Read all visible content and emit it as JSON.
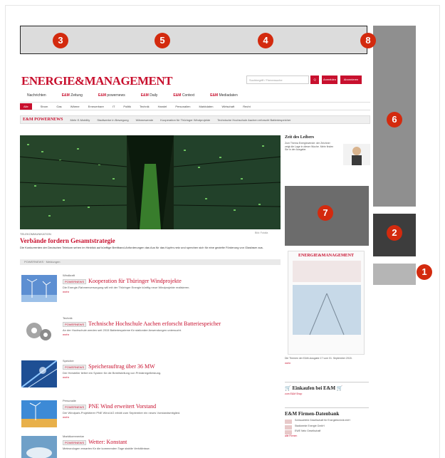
{
  "ad_slots": [
    {
      "number": "1",
      "color": "#b5b5b5"
    },
    {
      "number": "2",
      "color": "#3d3d3d"
    },
    {
      "number": "3",
      "color": "#dcdcdc"
    },
    {
      "number": "4",
      "color": "#dcdcdc"
    },
    {
      "number": "5",
      "color": "#dcdcdc"
    },
    {
      "number": "6",
      "color": "#8f8f8f"
    },
    {
      "number": "7",
      "color": "#6c6c6c"
    },
    {
      "number": "8",
      "color": "#dcdcdc"
    }
  ],
  "site": {
    "logo": "ENERGIE&MANAGEMENT",
    "search_placeholder": "Suchbegriff / Firmensuche",
    "search_button": "Q",
    "login_button": "Anmelden",
    "abo_button": "Abonnieren",
    "brand_color": "#c8102e",
    "nav_primary": [
      {
        "prefix": "",
        "label": "Nachrichten"
      },
      {
        "prefix": "E&M",
        "label": "Zeitung"
      },
      {
        "prefix": "E&M",
        "label": "powernews"
      },
      {
        "prefix": "E&M",
        "label": "Daily"
      },
      {
        "prefix": "E&M",
        "label": "Context"
      },
      {
        "prefix": "E&M",
        "label": "Mediadaten"
      }
    ],
    "nav_secondary": [
      "Alle",
      "Strom",
      "Gas",
      "Wärme",
      "Erneuerbare",
      "IT",
      "Politik",
      "Technik",
      "Handel",
      "Personalien",
      "Marktdaten",
      "Wirtschaft",
      "Recht"
    ],
    "ticker_brand": "E&M POWERNEWS",
    "ticker_items": [
      "Mehr E-Mobility",
      "Stadtwerke in Bewegung",
      "Wärmewende",
      "Kooperation für Thüringer Windprojekte",
      "Technische Hochschule Aachen erforscht Batteriespeicher"
    ],
    "hero": {
      "kicker": "Telekommunikation",
      "headline": "Verbände fordern Gesamtstrategie",
      "teaser": "Die Konkurrenten der Deutschen Telekom sehen im Hinblick auf künftige Breitband-Anforderungen das Aus für das Kupfer-netz und sprechen sich für eine gezielte Förderung von Glasfaser aus.",
      "more": "mehr",
      "credit": "Bild: Fotolia"
    },
    "section_bar": "POWERNEWS · Meldungen",
    "articles": [
      {
        "kicker": "Windkraft",
        "tag": "POWERNEWS",
        "title": "Kooperation für Thüringer Windprojekte",
        "teaser": "Die Energie-Rahmenversorgung will mit der Thüringer Energie künftig neue Windprojekte realisieren.",
        "more": "mehr"
      },
      {
        "kicker": "Technik",
        "tag": "POWERNEWS",
        "title": "Technische Hochschule Aachen erforscht Batteriespeicher",
        "teaser": "An der Hochschule werden seit 2015 Batteriesysteme für stationäre Anwendungen untersucht.",
        "more": "mehr"
      },
      {
        "kicker": "Speicher",
        "tag": "POWERNEWS",
        "title": "Speicherauftrag über 36 MW",
        "teaser": "Der Hersteller liefert ein System für die Bereitstellung von Primärregelleistung.",
        "more": "mehr"
      },
      {
        "kicker": "Personalie",
        "tag": "POWERNEWS",
        "title": "PNE Wind erweitert Vorstand",
        "teaser": "Der Windpark-Projektierer PNE Wind AG erhält zum September ein neues Vorstandsmitglied.",
        "more": "mehr"
      },
      {
        "kicker": "Marktkommentar",
        "tag": "POWERNEWS",
        "title": "Wetter: Konstant",
        "teaser": "Meteorologen erwarten für die kommenden Tage stabile Verhältnisse.",
        "more": "mehr"
      }
    ],
    "sidebar": {
      "cartoon_title": "Zeit des Leibers",
      "cartoon_text": "Zum Thema Energiewende: der Zeichner zeigt die Lage in dieser Woche. Mehr finden Sie in der Ausgabe.",
      "mag_logo": "ENERGIE&MANAGEMENT",
      "mag_caption": "Die Themen der E&M-Ausgabe 17 vom 01. September 2015.",
      "mag_more": "mehr",
      "shop_title": "Einkaufen bei E&M",
      "shop_more": "zum E&M Shop",
      "db_title": "E&M Firmen-Datenbank",
      "db_rows": [
        "Schlauchfeld Gesellschaft für Energietechnik mbH",
        "Stadtwerke Energie GmbH",
        "EWE Netz Gesellschaft"
      ],
      "db_more": "alle Firmen"
    }
  }
}
